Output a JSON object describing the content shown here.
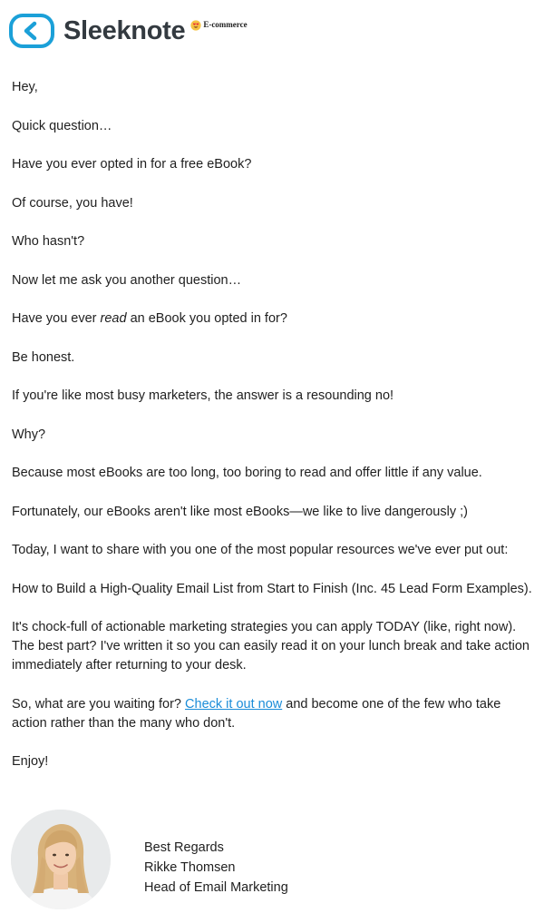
{
  "header": {
    "brand_name": "Sleeknote",
    "badge_text": "E-commerce",
    "logo_icon": "chevron-left-in-rounded-square-icon",
    "badge_icon": "heart-eyes-emoji-icon",
    "brand_color": "#1ba0d8"
  },
  "email": {
    "greeting": "Hey,",
    "p1": "Quick question…",
    "p2": "Have you ever opted in for a free eBook?",
    "p3": "Of course, you have!",
    "p4": "Who hasn't?",
    "p5": "Now let me ask you another question…",
    "p6_pre": "Have you ever ",
    "p6_em": "read",
    "p6_post": " an eBook you opted in for?",
    "p7": "Be honest.",
    "p8": "If you're like most busy marketers, the answer is a resounding no!",
    "p9": "Why?",
    "p10": "Because most eBooks are too long, too boring to read and offer little if any value.",
    "p11": "Fortunately, our eBooks aren't like most eBooks—we like to live dangerously ;)",
    "p12": "Today, I want to share with you one of the most popular resources we've ever put out:",
    "p13": "How to Build a High-Quality Email List from Start to Finish (Inc. 45 Lead Form Examples).",
    "p14": "It's chock-full of actionable marketing strategies you can apply TODAY (like, right now). The best part? I've written it so you can easily read it on your lunch break and take action immediately after returning to your desk.",
    "p15_pre": "So, what are you waiting for? ",
    "p15_link": "Check it out now",
    "p15_post": " and become one of the few who take action rather than the many who don't.",
    "closing": "Enjoy!",
    "link_color": "#1a8cd8"
  },
  "signature": {
    "sign_off": "Best Regards",
    "name": "Rikke Thomsen",
    "title": "Head of Email Marketing"
  }
}
